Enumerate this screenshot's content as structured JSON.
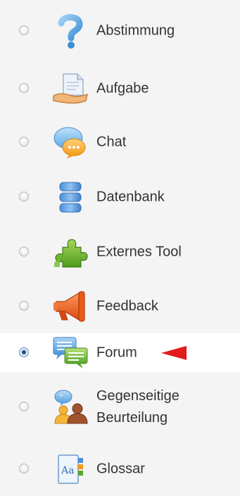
{
  "activities": [
    {
      "label": "Abstimmung",
      "icon": "question-mark-icon",
      "selected": false
    },
    {
      "label": "Aufgabe",
      "icon": "document-hand-icon",
      "selected": false
    },
    {
      "label": "Chat",
      "icon": "chat-bubbles-icon",
      "selected": false
    },
    {
      "label": "Datenbank",
      "icon": "database-icon",
      "selected": false
    },
    {
      "label": "Externes Tool",
      "icon": "puzzle-piece-icon",
      "selected": false
    },
    {
      "label": "Feedback",
      "icon": "megaphone-icon",
      "selected": false
    },
    {
      "label": "Forum",
      "icon": "forum-bubbles-icon",
      "selected": true
    },
    {
      "label_line1": "Gegenseitige",
      "label_line2": "Beurteilung",
      "icon": "peer-review-people-icon",
      "selected": false
    },
    {
      "label": "Glossar",
      "icon": "glossary-book-icon",
      "selected": false
    }
  ],
  "indicator": {
    "icon": "red-arrow-icon",
    "target": "Forum"
  },
  "colors": {
    "background": "#f4f4f4",
    "selected_background": "#ffffff",
    "text": "#333333",
    "arrow": "#e21b1b",
    "radio_selected": "#2c5f95"
  }
}
